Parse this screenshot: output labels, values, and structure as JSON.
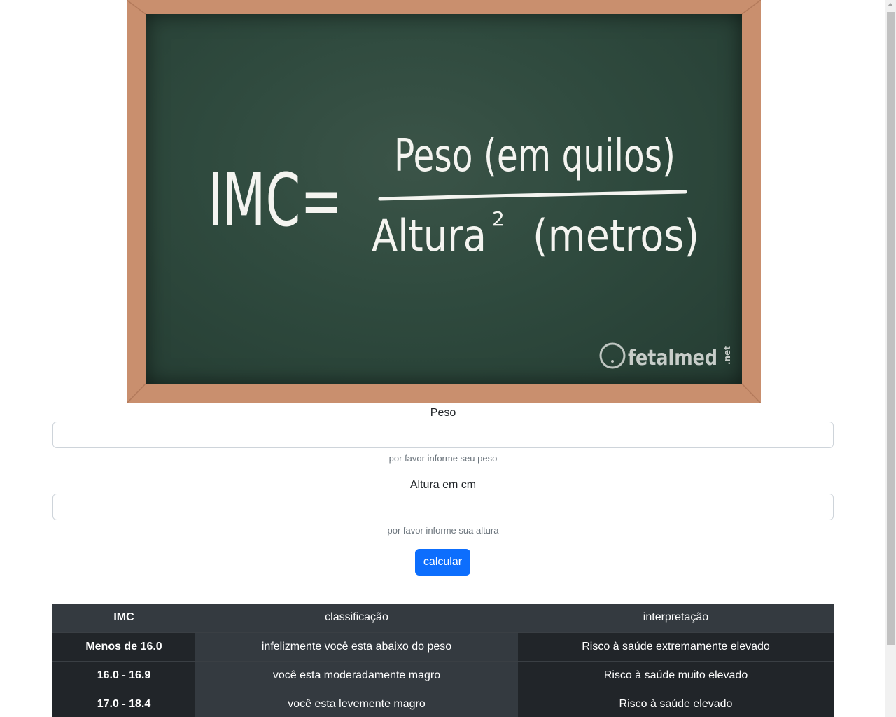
{
  "image": {
    "formula_left": "IMC=",
    "numerator": "Peso (em quilos)",
    "denominator_word": "Altura",
    "denominator_exponent": "2",
    "denominator_unit": "(metros)",
    "watermark": "fetalmed",
    "watermark_suffix": ".net"
  },
  "form": {
    "peso_label": "Peso",
    "peso_value": "",
    "peso_help": "por favor informe seu peso",
    "altura_label": "Altura em cm",
    "altura_value": "",
    "altura_help": "por favor informe sua altura",
    "submit_label": "calcular"
  },
  "table": {
    "headers": [
      "IMC",
      "classificação",
      "interpretação"
    ],
    "rows": [
      [
        "Menos de 16.0",
        "infelizmente você esta abaixo do peso",
        "Risco à saúde extremamente elevado"
      ],
      [
        "16.0 - 16.9",
        "você esta moderadamente magro",
        "Risco à saúde muito elevado"
      ],
      [
        "17.0 - 18.4",
        "você esta levemente magro",
        "Risco à saúde elevado"
      ]
    ]
  },
  "colors": {
    "primary_button": "#0d6efd",
    "table_dark": "#212529",
    "table_mid": "#343a40",
    "board_green": "#2f4a3e",
    "board_frame": "#c98f6e"
  }
}
